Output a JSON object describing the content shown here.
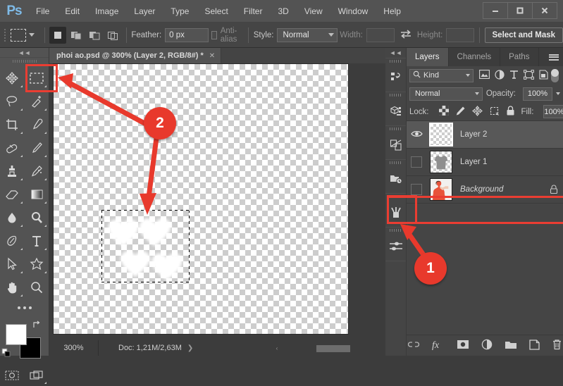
{
  "app": {
    "logo": "Ps",
    "menus": [
      "File",
      "Edit",
      "Image",
      "Layer",
      "Type",
      "Select",
      "Filter",
      "3D",
      "View",
      "Window",
      "Help"
    ],
    "window_buttons": [
      {
        "name": "minimize",
        "glyph": "—"
      },
      {
        "name": "maximize",
        "glyph": "▢"
      },
      {
        "name": "close",
        "glyph": "✕"
      }
    ]
  },
  "options_bar": {
    "tool_preset_icon": "rectangular-marquee-icon",
    "selection_modes": [
      "new-selection",
      "add-to-selection",
      "subtract-from-selection",
      "intersect-with-selection"
    ],
    "active_selection_mode": "new-selection",
    "feather_label": "Feather:",
    "feather_value": "0 px",
    "antialias_label": "Anti-alias",
    "antialias_checked": false,
    "style_label": "Style:",
    "style_value": "Normal",
    "width_label": "Width:",
    "width_value": "",
    "swap_icon": "swap-dimensions-icon",
    "height_label": "Height:",
    "height_value": "",
    "select_and_mask_label": "Select and Mask"
  },
  "toolbar": {
    "collapse_glyph": "◄◄",
    "tools": [
      [
        "move-tool",
        "rectangular-marquee-tool"
      ],
      [
        "lasso-tool",
        "quick-selection-tool"
      ],
      [
        "crop-tool",
        "eyedropper-tool"
      ],
      [
        "healing-brush-tool",
        "brush-tool"
      ],
      [
        "clone-stamp-tool",
        "history-brush-tool"
      ],
      [
        "eraser-tool",
        "gradient-tool"
      ],
      [
        "blur-tool",
        "dodge-tool"
      ],
      [
        "pen-tool",
        "type-tool"
      ],
      [
        "path-selection-tool",
        "custom-shape-tool"
      ],
      [
        "hand-tool",
        "zoom-tool"
      ],
      [
        "edit-toolbar-tool",
        ""
      ]
    ],
    "active_tool": "rectangular-marquee-tool",
    "foreground_color": "#ffffff",
    "background_color": "#000000",
    "swap_colors_icon": "swap-colors-icon",
    "default_colors_icon": "default-colors-icon",
    "quick_mask_icon": "quick-mask-icon",
    "screen_mode_icon": "screen-mode-icon"
  },
  "document": {
    "tab_title": "phoi ao.psd @ 300% (Layer 2, RGB/8#) *",
    "tab_close_glyph": "✕",
    "zoom_level": "300%",
    "doc_size": "Doc: 1,21M/2,63M",
    "status_chevron": "❯",
    "scroll_left_glyph": "‹",
    "scroll_right_glyph": "›",
    "scroll_up_glyph": "▲",
    "scroll_down_glyph": "▼"
  },
  "icon_dock": {
    "collapse_glyph": "◄◄",
    "items": [
      "history-panel-icon",
      "3d-panel-icon",
      "adjustments-panel-icon",
      "libraries-panel-icon",
      "brushes-panel-icon",
      "brush-settings-panel-icon"
    ]
  },
  "layers_panel": {
    "tabs": [
      {
        "label": "Layers",
        "active": true
      },
      {
        "label": "Channels",
        "active": false
      },
      {
        "label": "Paths",
        "active": false
      }
    ],
    "menu_icon": "panel-menu-icon",
    "filter_kind_label": "Kind",
    "filter_search_icon": "search-icon",
    "filter_icons": [
      "filter-pixel-icon",
      "filter-adjustment-icon",
      "filter-type-icon",
      "filter-shape-icon",
      "filter-smart-object-icon"
    ],
    "filter_toggle": "filter-enable-toggle",
    "blend_mode": "Normal",
    "opacity_label": "Opacity:",
    "opacity_value": "100%",
    "lock_label": "Lock:",
    "lock_icons": [
      "lock-transparent-pixels-icon",
      "lock-image-pixels-icon",
      "lock-position-icon",
      "lock-artboard-icon",
      "lock-all-icon"
    ],
    "fill_label": "Fill:",
    "fill_value": "100%",
    "layers": [
      {
        "name": "Layer 2",
        "visible": true,
        "selected": true,
        "thumb": "transparent",
        "locked": false,
        "italic": false
      },
      {
        "name": "Layer 1",
        "visible": false,
        "selected": false,
        "thumb": "shirt-gray",
        "locked": false,
        "italic": false
      },
      {
        "name": "Background",
        "visible": false,
        "selected": false,
        "thumb": "model-photo",
        "locked": true,
        "italic": true
      }
    ],
    "bottom_buttons": [
      "link-layers-icon",
      "layer-style-fx-icon",
      "add-layer-mask-icon",
      "new-adjustment-layer-icon",
      "new-group-icon",
      "new-layer-icon",
      "delete-layer-icon"
    ]
  },
  "annotations": {
    "accent_color": "#e8392c",
    "badges": [
      {
        "label": "1",
        "target": "background-layer-visibility-toggle"
      },
      {
        "label": "2",
        "target": "rectangular-marquee-tool-and-canvas-selection"
      }
    ],
    "highlight_boxes": [
      {
        "name": "marquee-tool-highlight"
      },
      {
        "name": "background-eye-highlight"
      },
      {
        "name": "brush-settings-dock-highlight"
      }
    ]
  }
}
